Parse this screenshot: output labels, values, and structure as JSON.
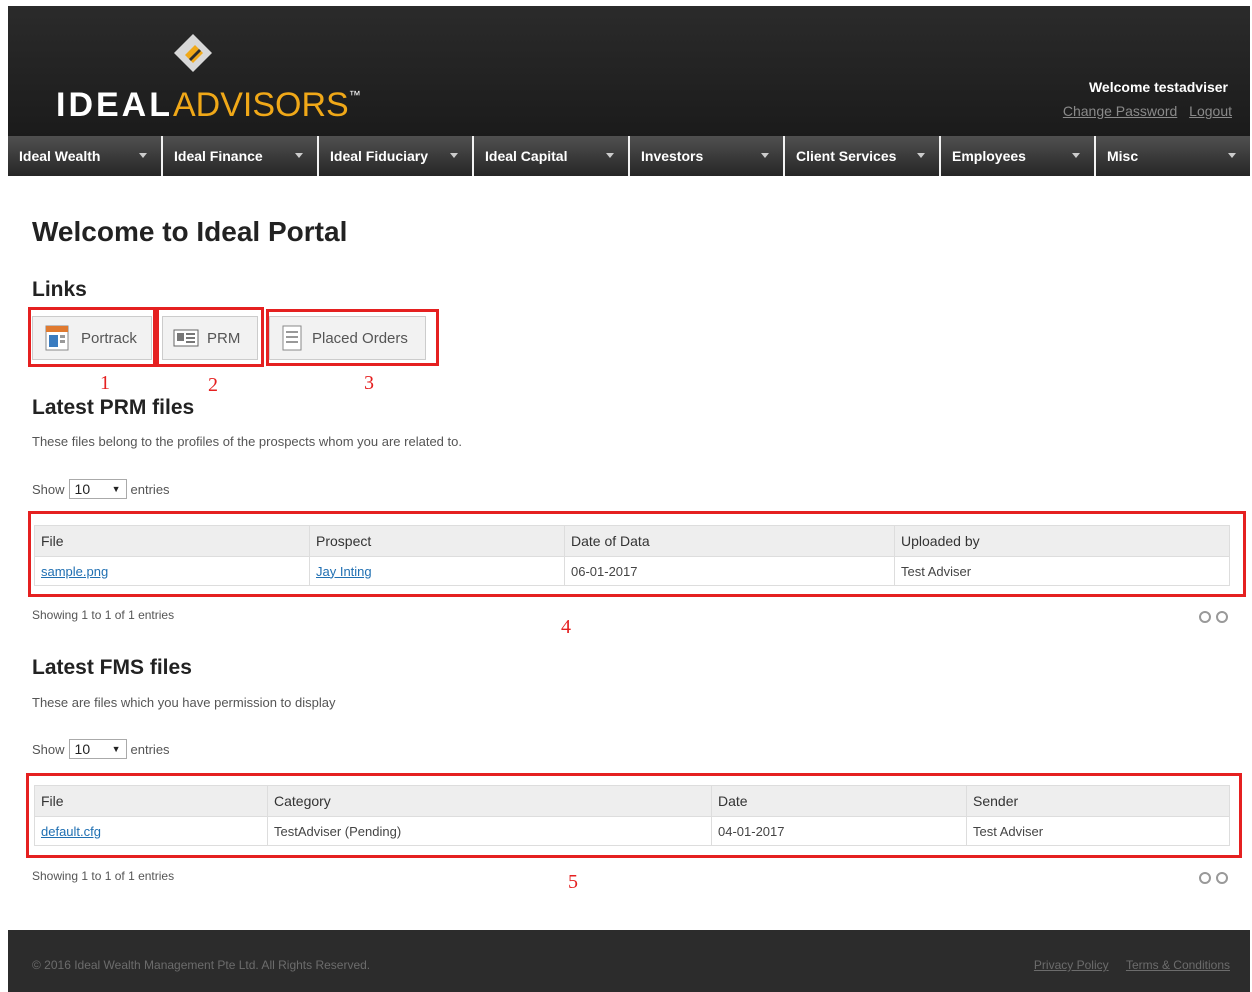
{
  "header": {
    "logo_bold": "IDEAL",
    "logo_light": "ADVISORS",
    "logo_tm": "™",
    "welcome": "Welcome testadviser",
    "change_password": "Change Password",
    "logout": "Logout"
  },
  "nav": [
    {
      "label": "Ideal Wealth"
    },
    {
      "label": "Ideal Finance"
    },
    {
      "label": "Ideal Fiduciary"
    },
    {
      "label": "Ideal Capital"
    },
    {
      "label": "Investors"
    },
    {
      "label": "Client Services"
    },
    {
      "label": "Employees"
    },
    {
      "label": "Misc"
    }
  ],
  "page_title": "Welcome to Ideal Portal",
  "links": {
    "title": "Links",
    "items": [
      {
        "label": "Portrack",
        "icon": "portrack-icon",
        "marker": "1"
      },
      {
        "label": "PRM",
        "icon": "prm-card-icon",
        "marker": "2"
      },
      {
        "label": "Placed Orders",
        "icon": "document-icon",
        "marker": "3"
      }
    ]
  },
  "prm": {
    "title": "Latest PRM files",
    "description": "These files belong to the profiles of the prospects whom you are related to.",
    "show_label": "Show",
    "entries_value": "10",
    "entries_label": "entries",
    "columns": [
      "File",
      "Prospect",
      "Date of Data",
      "Uploaded by"
    ],
    "rows": [
      {
        "file": "sample.png",
        "prospect": "Jay Inting",
        "date": "06-01-2017",
        "uploaded_by": "Test Adviser"
      }
    ],
    "info": "Showing 1 to 1 of 1 entries",
    "marker": "4"
  },
  "fms": {
    "title": "Latest FMS files",
    "description": "These are files which you have permission to display",
    "show_label": "Show",
    "entries_value": "10",
    "entries_label": "entries",
    "columns": [
      "File",
      "Category",
      "Date",
      "Sender"
    ],
    "rows": [
      {
        "file": "default.cfg",
        "category": "TestAdviser (Pending)",
        "date": "04-01-2017",
        "sender": "Test Adviser"
      }
    ],
    "info": "Showing 1 to 1 of 1 entries",
    "marker": "5"
  },
  "footer": {
    "copyright": "© 2016 Ideal Wealth Management Pte Ltd. All Rights Reserved.",
    "privacy": "Privacy Policy",
    "terms": "Terms & Conditions"
  },
  "colors": {
    "accent": "#f0a818",
    "annotation": "#e52020",
    "link": "#1f6fb2"
  }
}
